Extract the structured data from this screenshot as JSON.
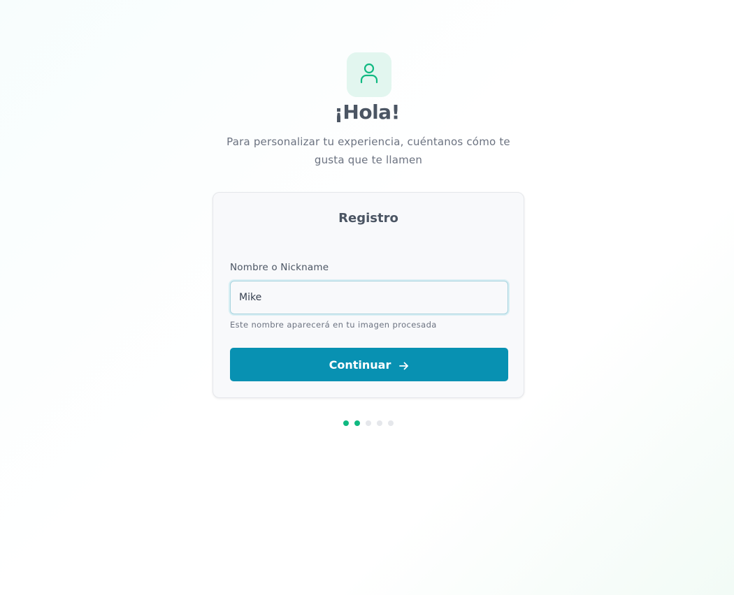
{
  "header": {
    "icon": "user-icon",
    "title": "¡Hola!",
    "subtitle": "Para personalizar tu experiencia, cuéntanos cómo te gusta que te llamen"
  },
  "card": {
    "title": "Registro",
    "field": {
      "label": "Nombre o Nickname",
      "value": "Mike",
      "help": "Este nombre aparecerá en tu imagen procesada"
    },
    "button": {
      "label": "Continuar",
      "icon": "arrow-right-icon"
    }
  },
  "progress": {
    "total_steps": 5,
    "completed_steps": 2
  },
  "colors": {
    "accent_green": "#10b981",
    "button_blue": "#0891b2",
    "icon_tile_bg": "#e2f6ef"
  }
}
